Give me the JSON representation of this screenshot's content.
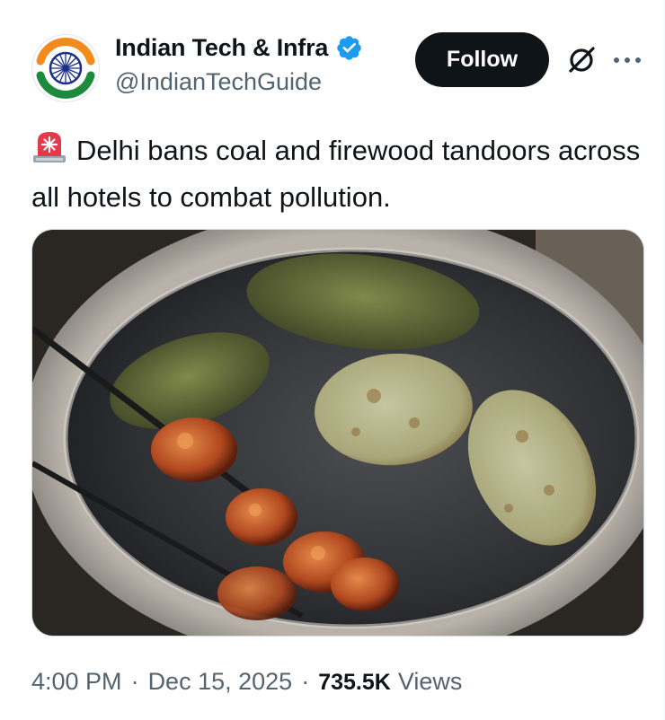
{
  "header": {
    "display_name": "Indian Tech & Infra",
    "handle": "@IndianTechGuide",
    "follow_label": "Follow",
    "verified_icon": "verified-badge-icon",
    "grok_icon": "grok-icon",
    "more_icon": "more-options-icon"
  },
  "tweet": {
    "emoji": "rotating-light-icon",
    "text": "Delhi bans coal and firewood tandoors across all hotels to combat pollution."
  },
  "footer": {
    "time": "4:00 PM",
    "date": "Dec 15, 2025",
    "views_count": "735.5K",
    "views_label": "Views",
    "separator": "·"
  },
  "colors": {
    "text": "#0f1419",
    "secondary": "#536471",
    "verified": "#1d9bf0",
    "follow_bg": "#0f1419"
  }
}
